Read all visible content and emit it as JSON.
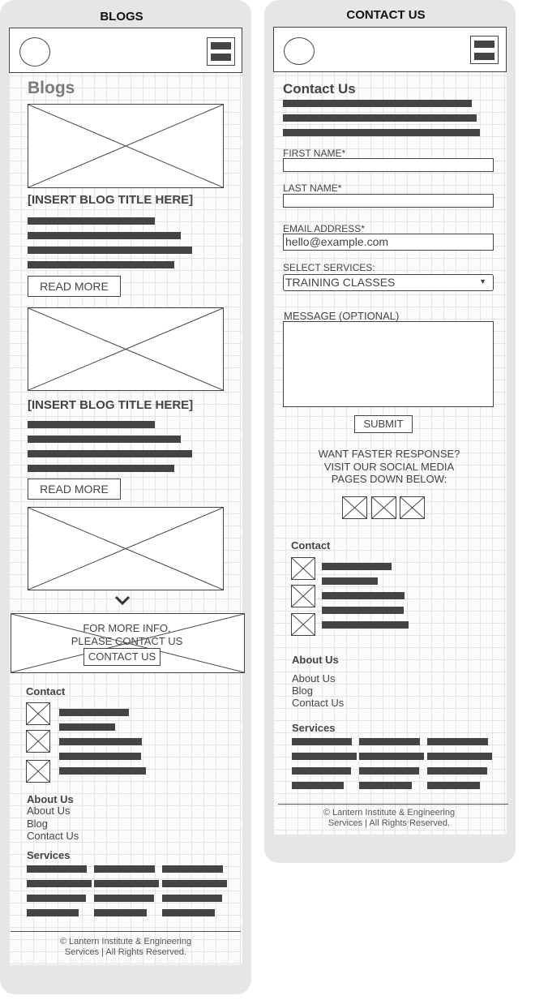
{
  "blogs_screen": {
    "frame_title": "BLOGS",
    "page_heading": "Blogs",
    "posts": [
      {
        "title": "[INSERT BLOG TITLE HERE]",
        "button": "READ MORE"
      },
      {
        "title": "[INSERT BLOG TITLE HERE]",
        "button": "READ MORE"
      }
    ],
    "more_icon": "chevron-down-icon",
    "cta": {
      "line1": "FOR MORE INFO,",
      "line2": "PLEASE CONTACT US",
      "button": "CONTACT US"
    }
  },
  "contact_screen": {
    "frame_title": "CONTACT US",
    "page_heading": "Contact Us",
    "form": {
      "first_name_label": "FIRST NAME*",
      "last_name_label": "LAST NAME*",
      "email_label": "EMAIL ADDRESS*",
      "email_value": "hello@example.com",
      "services_label": "SELECT SERVICES:",
      "services_selected": "TRAINING CLASSES",
      "message_label": "MESSAGE (OPTIONAL)",
      "submit": "SUBMIT"
    },
    "social": {
      "line1": "WANT FASTER RESPONSE?",
      "line2": "VISIT OUR SOCIAL MEDIA",
      "line3": "PAGES DOWN BELOW:"
    }
  },
  "footer": {
    "contact_heading": "Contact",
    "about_heading": "About Us",
    "about_links": [
      "About Us",
      "Blog",
      "Contact Us"
    ],
    "services_heading": "Services",
    "copyright_line1": "© Lantern Institute & Engineering",
    "copyright_line2": "Services | All Rights Reserved."
  },
  "colors": {
    "frame": "#e6e6e6",
    "wire": "#444444",
    "grid": "#e4e4e4"
  }
}
